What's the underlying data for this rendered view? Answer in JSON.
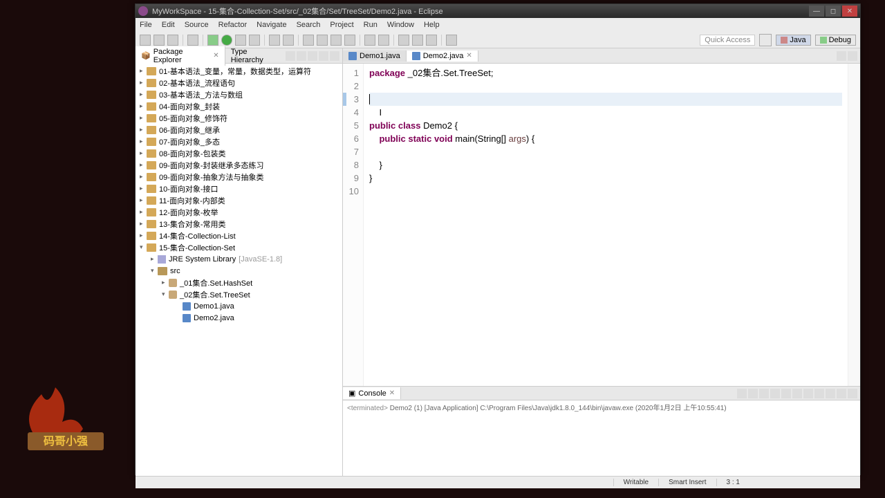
{
  "window": {
    "title": "MyWorkSpace - 15-集合-Collection-Set/src/_02集合/Set/TreeSet/Demo2.java - Eclipse"
  },
  "menus": [
    "File",
    "Edit",
    "Source",
    "Refactor",
    "Navigate",
    "Search",
    "Project",
    "Run",
    "Window",
    "Help"
  ],
  "toolbar_right": {
    "quick_access": "Quick Access",
    "java": "Java",
    "debug": "Debug"
  },
  "package_explorer": {
    "title": "Package Explorer",
    "type_hierarchy": "Type Hierarchy",
    "projects": [
      "01-基本语法_变量，常量，数据类型，运算符",
      "02-基本语法_流程语句",
      "03-基本语法_方法与数组",
      "04-面向对象_封装",
      "05-面向对象_修饰符",
      "06-面向对象_继承",
      "07-面向对象_多态",
      "08-面向对象-包装类",
      "09-面向对象-封装继承多态练习",
      "09-面向对象-抽象方法与抽象类",
      "10-面向对象-接口",
      "11-面向对象-内部类",
      "12-面向对象-枚举",
      "13-集合对象-常用类",
      "14-集合-Collection-List"
    ],
    "open_project": "15-集合-Collection-Set",
    "jre_label": "JRE System Library",
    "jre_suffix": "[JavaSE-1.8]",
    "src_label": "src",
    "packages": [
      {
        "name": "_01集合.Set.HashSet",
        "open": false
      },
      {
        "name": "_02集合.Set.TreeSet",
        "open": true
      }
    ],
    "files": [
      "Demo1.java",
      "Demo2.java"
    ]
  },
  "editor": {
    "tabs": [
      {
        "label": "Demo1.java",
        "active": false
      },
      {
        "label": "Demo2.java",
        "active": true
      }
    ],
    "lines": {
      "1": {
        "pkg": "package",
        "rest": " _02集合.Set.TreeSet;"
      },
      "5": {
        "pub": "public",
        "cls": "class",
        "name": " Demo2 {"
      },
      "6": {
        "pub": "public",
        "stat": "static",
        "void": "void",
        "main": " main(String[] ",
        "args": "args",
        "close": ") {"
      },
      "8": "    }",
      "9": "}"
    }
  },
  "console": {
    "title": "Console",
    "status_prefix": "<terminated>",
    "status_rest": " Demo2 (1) [Java Application] C:\\Program Files\\Java\\jdk1.8.0_144\\bin\\javaw.exe (2020年1月2日 上午10:55:41)"
  },
  "statusbar": {
    "writable": "Writable",
    "insert": "Smart Insert",
    "pos": "3 : 1"
  }
}
